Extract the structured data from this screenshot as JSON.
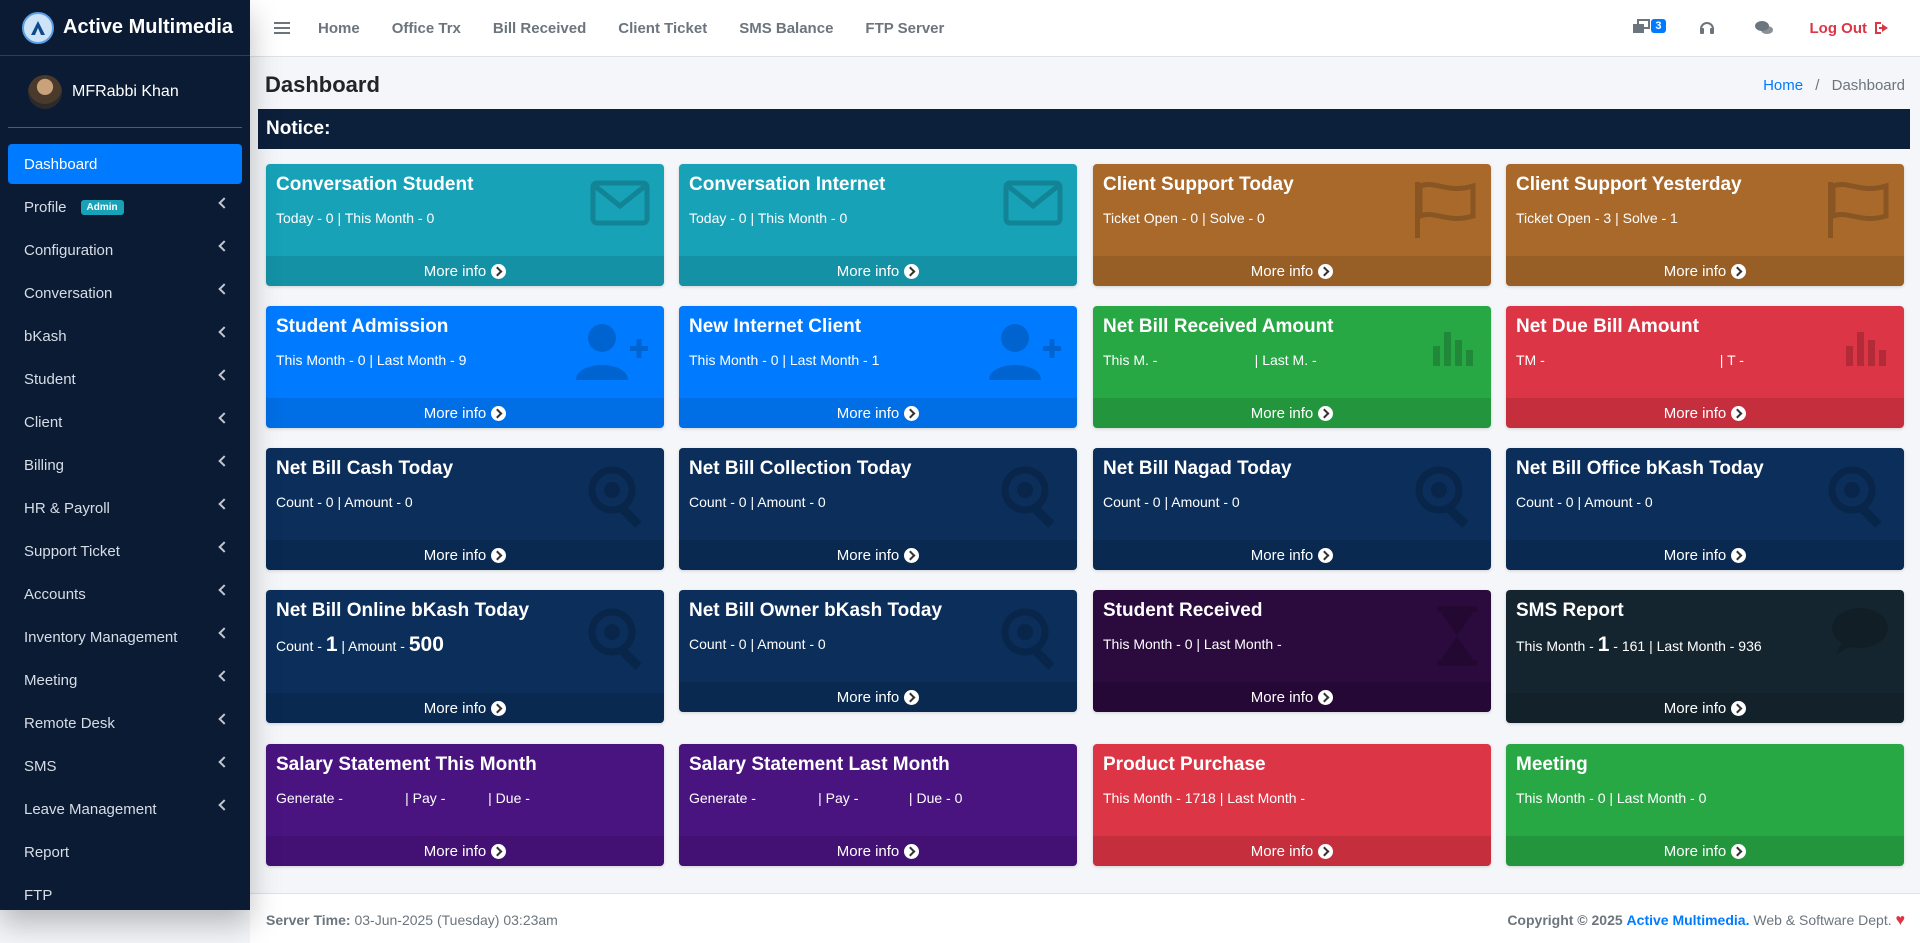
{
  "brand": {
    "name": "Active Multimedia"
  },
  "user": {
    "name": "MFRabbi Khan"
  },
  "sidebar": {
    "items": [
      {
        "label": "Dashboard",
        "active": true,
        "chevron": false
      },
      {
        "label": "Profile",
        "badge": "Admin",
        "chevron": true
      },
      {
        "label": "Configuration",
        "chevron": true
      },
      {
        "label": "Conversation",
        "chevron": true
      },
      {
        "label": "bKash",
        "chevron": true
      },
      {
        "label": "Student",
        "chevron": true
      },
      {
        "label": "Client",
        "chevron": true
      },
      {
        "label": "Billing",
        "chevron": true
      },
      {
        "label": "HR & Payroll",
        "chevron": true
      },
      {
        "label": "Support Ticket",
        "chevron": true
      },
      {
        "label": "Accounts",
        "chevron": true
      },
      {
        "label": "Inventory Management",
        "chevron": true
      },
      {
        "label": "Meeting",
        "chevron": true
      },
      {
        "label": "Remote Desk",
        "chevron": true
      },
      {
        "label": "SMS",
        "chevron": true
      },
      {
        "label": "Leave Management",
        "chevron": true
      },
      {
        "label": "Report",
        "chevron": false
      },
      {
        "label": "FTP",
        "chevron": false
      }
    ]
  },
  "topnav": {
    "links": [
      "Home",
      "Office Trx",
      "Bill Received",
      "Client Ticket",
      "SMS Balance",
      "FTP Server"
    ],
    "notification_count": "3",
    "logout_label": "Log Out"
  },
  "header": {
    "title": "Dashboard",
    "breadcrumb_home": "Home",
    "breadcrumb_sep": "/",
    "breadcrumb_current": "Dashboard"
  },
  "notice": {
    "label": "Notice:"
  },
  "cards": [
    {
      "title": "Conversation Student",
      "text": "Today - 0 | This Month - 0",
      "color": "#17a2b8",
      "icon": "envelope-icon"
    },
    {
      "title": "Conversation Internet",
      "text": "Today - 0 | This Month - 0",
      "color": "#17a2b8",
      "icon": "envelope-icon"
    },
    {
      "title": "Client Support Today",
      "text": "Ticket Open - 0 | Solve - 0",
      "color": "#a9692b",
      "icon": "flag-icon"
    },
    {
      "title": "Client Support Yesterday",
      "text": "Ticket Open - 3 | Solve - 1",
      "color": "#a9692b",
      "icon": "flag-icon"
    },
    {
      "title": "Student Admission",
      "text": "This Month - 0 | Last Month - 9",
      "color": "#007bff",
      "icon": "user-plus-icon"
    },
    {
      "title": "New Internet Client",
      "text": "This Month - 0 | Last Month - 1",
      "color": "#007bff",
      "icon": "user-plus-icon"
    },
    {
      "title": "Net Bill Received Amount",
      "text": "This M. -                         | Last M. -",
      "color": "#28a745",
      "icon": "bar-chart-icon"
    },
    {
      "title": "Net Due Bill Amount",
      "text": "TM -                                             | T -",
      "color": "#dc3545",
      "icon": "bar-chart-icon"
    },
    {
      "title": "Net Bill Cash Today",
      "text": "Count - 0 | Amount - 0",
      "color": "#0b2e5b",
      "icon": "search-icon"
    },
    {
      "title": "Net Bill Collection Today",
      "text": "Count - 0 | Amount - 0",
      "color": "#0b2e5b",
      "icon": "search-icon"
    },
    {
      "title": "Net Bill Nagad Today",
      "text": "Count - 0 | Amount - 0",
      "color": "#0b2e5b",
      "icon": "search-icon"
    },
    {
      "title": "Net Bill Office bKash Today",
      "text": "Count - 0 | Amount - 0",
      "color": "#0b2e5b",
      "icon": "search-icon"
    },
    {
      "title": "Net Bill Online bKash Today",
      "text_parts": [
        "Count - ",
        "1",
        " | Amount - ",
        "500"
      ],
      "color": "#0b2e5b",
      "icon": "search-icon"
    },
    {
      "title": "Net Bill Owner bKash Today",
      "text": "Count - 0 | Amount - 0",
      "color": "#0b2e5b",
      "icon": "search-icon"
    },
    {
      "title": "Student Received",
      "text": "This Month - 0 | Last Month -",
      "color": "#2b0a3d",
      "icon": "hourglass-icon"
    },
    {
      "title": "SMS Report",
      "text_parts": [
        "This Month - ",
        "1",
        " - 161 | Last Month - 936"
      ],
      "color": "#15252f",
      "icon": "chat-icon"
    },
    {
      "title": "Salary Statement This Month",
      "text": "Generate -                | Pay -           | Due -",
      "color": "#4a1480",
      "icon": ""
    },
    {
      "title": "Salary Statement Last Month",
      "text": "Generate -                | Pay -             | Due - 0",
      "color": "#4a1480",
      "icon": ""
    },
    {
      "title": "Product Purchase",
      "text": "This Month - 1718 | Last Month -",
      "color": "#dc3545",
      "icon": ""
    },
    {
      "title": "Meeting",
      "text": "This Month - 0 | Last Month - 0",
      "color": "#28a745",
      "icon": ""
    }
  ],
  "more_info_label": "More info",
  "footer": {
    "server_time_label": "Server Time:",
    "server_time_value": "03-Jun-2025 (Tuesday) 03:23am",
    "copyright_prefix": "Copyright © 2025",
    "copyright_brand": "Active Multimedia.",
    "copyright_suffix": "Web & Software Dept."
  }
}
